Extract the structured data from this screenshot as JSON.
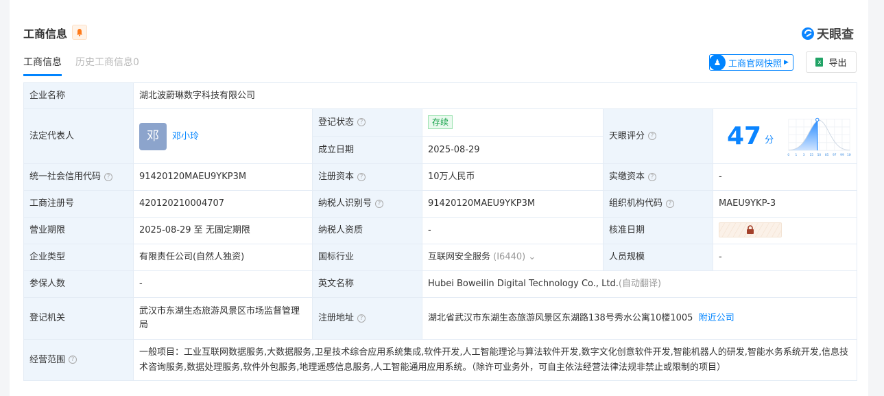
{
  "header": {
    "title": "工商信息",
    "logo": "天眼查",
    "snapshot_button": "工商官网快照",
    "export_button": "导出"
  },
  "tabs": [
    {
      "label": "工商信息",
      "active": true
    },
    {
      "label": "历史工商信息0",
      "active": false
    }
  ],
  "colors": {
    "accent": "#0084ff",
    "label_bg": "#eef5fc"
  },
  "info": {
    "company_name_label": "企业名称",
    "company_name": "湖北波蔚琳数字科技有限公司",
    "legal_rep_label": "法定代表人",
    "legal_rep_avatar": "邓",
    "legal_rep": "邓小玲",
    "status_label": "登记状态",
    "status": "存续",
    "founded_label": "成立日期",
    "founded": "2025-08-29",
    "score_label": "天眼评分",
    "score": "47",
    "score_unit": "分",
    "score_ticks": [
      "0",
      "1",
      "3",
      "15",
      "50",
      "85",
      "97",
      "99",
      "100"
    ],
    "credit_code_label": "统一社会信用代码",
    "credit_code": "91420120MAEU9YKP3M",
    "reg_capital_label": "注册资本",
    "reg_capital": "10万人民币",
    "paid_capital_label": "实缴资本",
    "paid_capital": "-",
    "reg_no_label": "工商注册号",
    "reg_no": "420120210004707",
    "taxpayer_id_label": "纳税人识别号",
    "taxpayer_id": "91420120MAEU9YKP3M",
    "org_code_label": "组织机构代码",
    "org_code": "MAEU9YKP-3",
    "term_label": "营业期限",
    "term": "2025-08-29 至 无固定期限",
    "taxpayer_qual_label": "纳税人资质",
    "taxpayer_qual": "-",
    "approval_date_label": "核准日期",
    "type_label": "企业类型",
    "type": "有限责任公司(自然人独资)",
    "industry_label": "国标行业",
    "industry": "互联网安全服务",
    "industry_code": "(I6440)",
    "staff_label": "人员规模",
    "staff": "-",
    "insured_label": "参保人数",
    "insured": "-",
    "english_name_label": "英文名称",
    "english_name": "Hubei Boweilin Digital Technology Co., Ltd.",
    "english_note": "(自动翻译)",
    "authority_label": "登记机关",
    "authority": "武汉市东湖生态旅游风景区市场监督管理局",
    "address_label": "注册地址",
    "address": "湖北省武汉市东湖生态旅游风景区东湖路138号秀水公寓10楼1005",
    "nearby": "附近公司",
    "scope_label": "经营范围",
    "scope": "一般项目：工业互联网数据服务,大数据服务,卫星技术综合应用系统集成,软件开发,人工智能理论与算法软件开发,数字文化创意软件开发,智能机器人的研发,智能水务系统开发,信息技术咨询服务,数据处理服务,软件外包服务,地理遥感信息服务,人工智能通用应用系统。（除许可业务外，可自主依法经营法律法规非禁止或限制的项目）"
  }
}
